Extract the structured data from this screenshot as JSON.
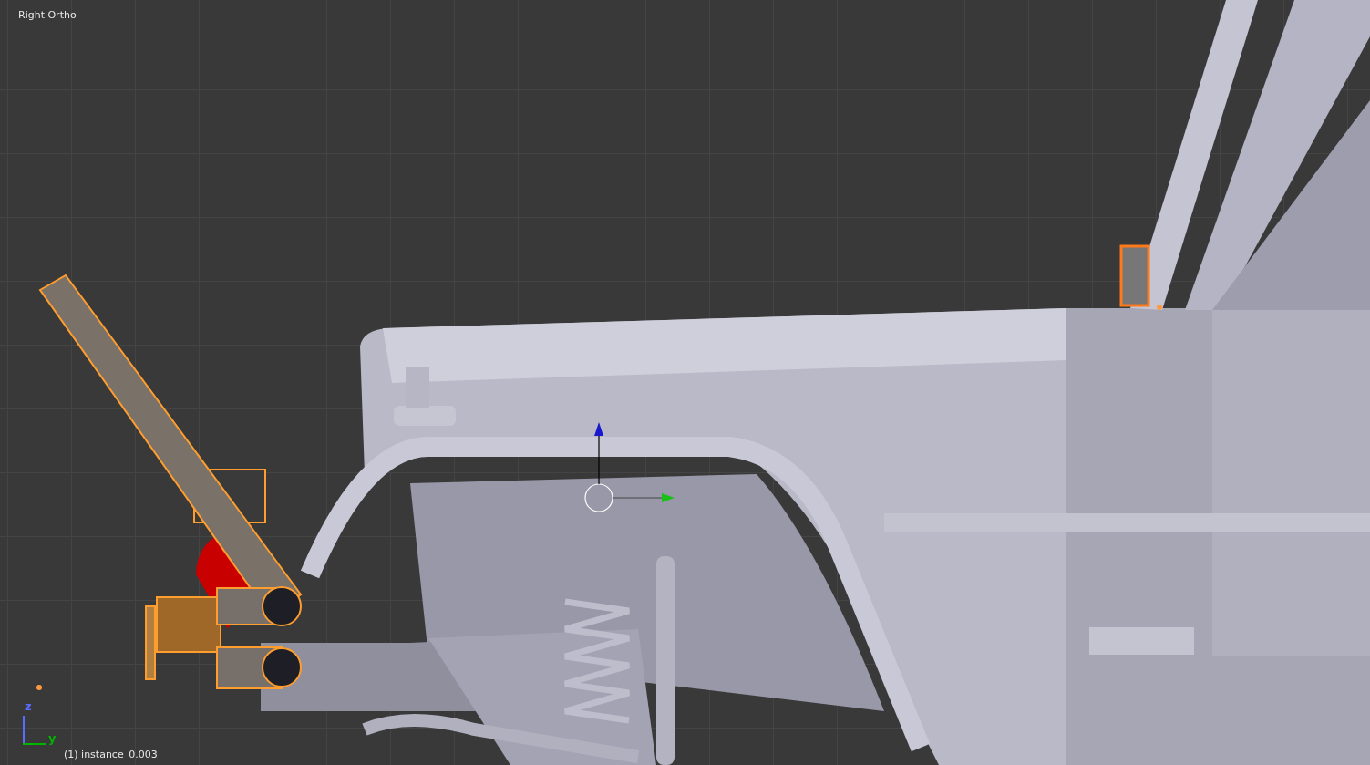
{
  "viewport": {
    "view_name": "Right Ortho",
    "object_label": "(1) instance_0.003",
    "axes": [
      {
        "label": "z",
        "color": "#5a6cff"
      },
      {
        "label": "y",
        "color": "#00b400"
      }
    ]
  }
}
